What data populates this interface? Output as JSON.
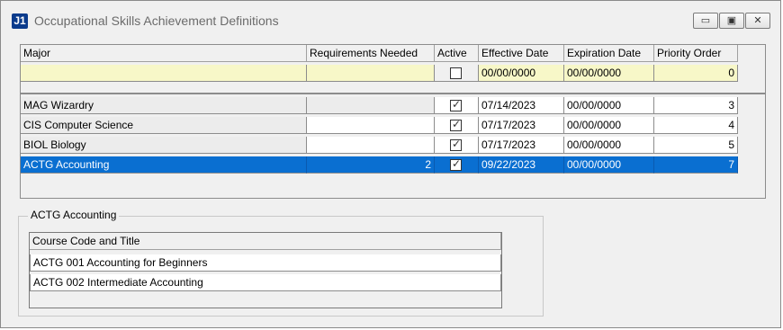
{
  "window": {
    "icon_text": "J1",
    "title": "Occupational Skills Achievement Definitions",
    "min_glyph": "▭",
    "max_glyph": "▣",
    "close_glyph": "✕"
  },
  "grid": {
    "headers": [
      "Major",
      "Requirements Needed",
      "Active",
      "Effective Date",
      "Expiration Date",
      "Priority Order"
    ],
    "filter_row": {
      "major": "",
      "requirements": "",
      "active": false,
      "effective": "00/00/0000",
      "expiration": "00/00/0000",
      "priority": "0"
    },
    "rows": [
      {
        "major": "MAG   Wizardry",
        "requirements": "",
        "active": true,
        "effective": "07/14/2023",
        "expiration": "00/00/0000",
        "priority": "3"
      },
      {
        "major": "CIS   Computer Science",
        "requirements": "",
        "active": true,
        "effective": "07/17/2023",
        "expiration": "00/00/0000",
        "priority": "4"
      },
      {
        "major": "BIOL   Biology",
        "requirements": "",
        "active": true,
        "effective": "07/17/2023",
        "expiration": "00/00/0000",
        "priority": "5"
      },
      {
        "major": "ACTG   Accounting",
        "requirements": "2",
        "active": true,
        "effective": "09/22/2023",
        "expiration": "00/00/0000",
        "priority": "7"
      }
    ]
  },
  "detail": {
    "group_label": "ACTG   Accounting",
    "header": "Course Code and Title",
    "courses": [
      "ACTG 001   Accounting for Beginners",
      "ACTG 002   Intermediate Accounting"
    ]
  },
  "colors": {
    "selection": "#0a6fd1",
    "filter_row": "#f7f7c8",
    "app_icon": "#0b3b8c"
  }
}
